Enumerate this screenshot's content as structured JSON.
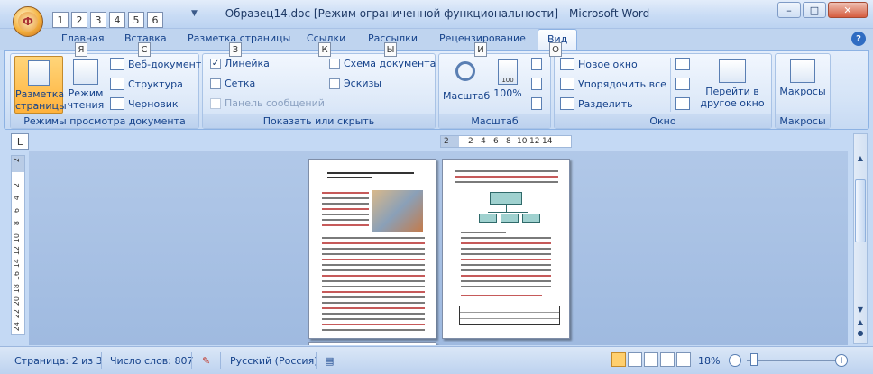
{
  "window": {
    "title": "Образец14.doc [Режим ограниченной функциональности] - Microsoft Word",
    "office_button_keytip": "Ф",
    "qat_keytips": [
      "1",
      "2",
      "3",
      "4",
      "5",
      "6"
    ],
    "minimize": "–",
    "maximize": "□",
    "close": "✕"
  },
  "tabs": [
    {
      "label": "Главная",
      "keytip": "Я"
    },
    {
      "label": "Вставка",
      "keytip": "С"
    },
    {
      "label": "Разметка страницы",
      "keytip": "З"
    },
    {
      "label": "Ссылки",
      "keytip": "К"
    },
    {
      "label": "Рассылки",
      "keytip": "Ы"
    },
    {
      "label": "Рецензирование",
      "keytip": "И"
    },
    {
      "label": "Вид",
      "keytip": "О",
      "active": true
    }
  ],
  "help": "?",
  "ribbon": {
    "views": {
      "label": "Режимы просмотра документа",
      "page_layout": "Разметка страницы",
      "reading": "Режим чтения",
      "web": "Веб-документ",
      "outline": "Структура",
      "draft": "Черновик"
    },
    "show": {
      "label": "Показать или скрыть",
      "ruler": "Линейка",
      "gridlines": "Сетка",
      "message_bar": "Панель сообщений",
      "doc_map": "Схема документа",
      "thumbnails": "Эскизы",
      "ruler_checked": true
    },
    "zoom": {
      "label": "Масштаб",
      "zoom": "Масштаб",
      "hundred": "100%",
      "hundred_icon": "100"
    },
    "window": {
      "label": "Окно",
      "new_window": "Новое окно",
      "arrange_all": "Упорядочить все",
      "split": "Разделить",
      "switch_windows": "Перейти в другое окно"
    },
    "macros": {
      "label": "Макросы",
      "macros": "Макросы"
    }
  },
  "ruler": {
    "tab_selector": "L",
    "h_ticks": [
      "2",
      "2",
      "4",
      "6",
      "8",
      "10",
      "12",
      "14"
    ],
    "v_ticks": [
      "2",
      "2",
      "4",
      "6",
      "8",
      "10",
      "12",
      "14",
      "16",
      "18",
      "20",
      "22",
      "24"
    ]
  },
  "status": {
    "page": "Страница: 2 из 3",
    "words": "Число слов: 807",
    "language": "Русский (Россия)",
    "zoom": "18%",
    "zoom_level": 0.18
  }
}
